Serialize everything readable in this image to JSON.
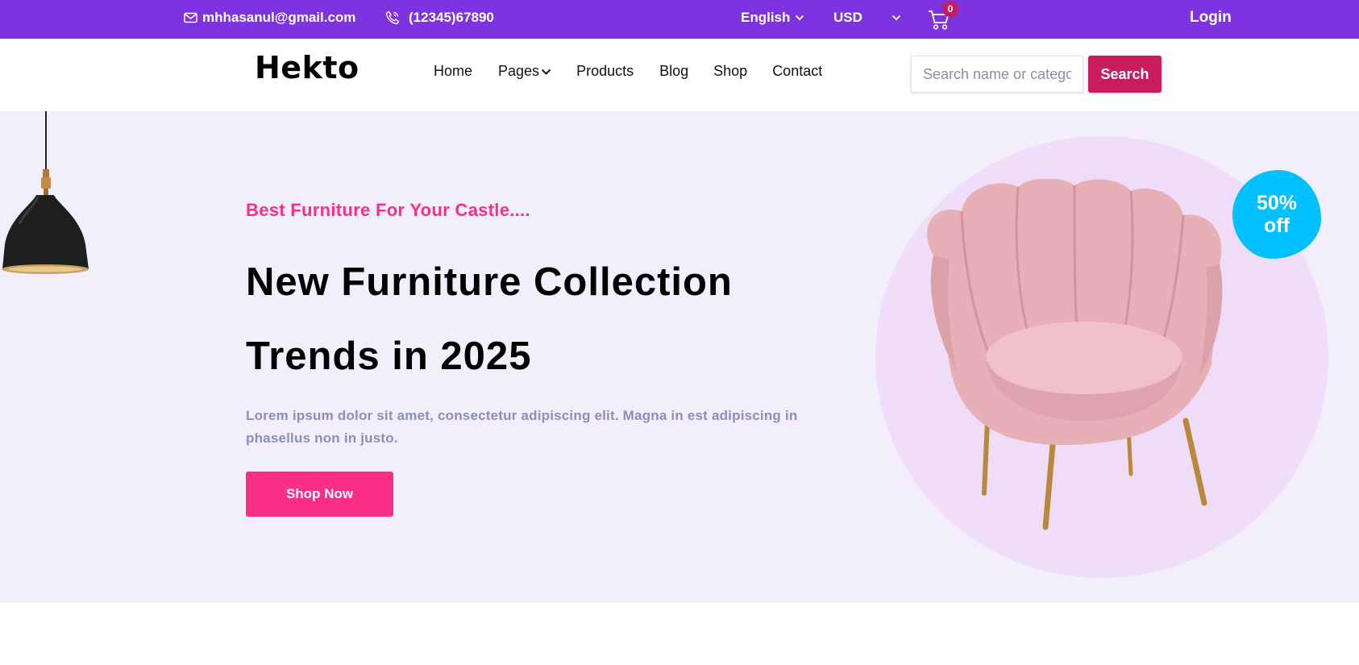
{
  "topbar": {
    "email": "mhhasanul@gmail.com",
    "phone": "(12345)67890",
    "language": "English",
    "currency": "USD",
    "cart_count": "0",
    "login": "Login",
    "icons": [
      "mail-icon",
      "phone-icon",
      "chevron-down-icon",
      "cart-icon"
    ]
  },
  "nav": {
    "logo": "Hekto",
    "links": [
      "Home",
      "Pages",
      "Products",
      "Blog",
      "Shop",
      "Contact"
    ],
    "search_placeholder": "Search name or category",
    "search_button": "Search"
  },
  "hero": {
    "tagline": "Best Furniture For Your Castle....",
    "title_line1": "New Furniture Collection",
    "title_line2": "Trends in 2025",
    "description": "Lorem ipsum dolor sit amet, consectetur adipiscing elit. Magna in est adipiscing in phasellus non in justo.",
    "cta": "Shop Now",
    "discount_line1": "50%",
    "discount_line2": "off"
  },
  "colors": {
    "topbar": "#7E33E0",
    "accent_pink": "#FB2E86",
    "search_button": "#C81C5C",
    "hero_bg": "#F2EEFC",
    "badge": "#00C1FE"
  }
}
